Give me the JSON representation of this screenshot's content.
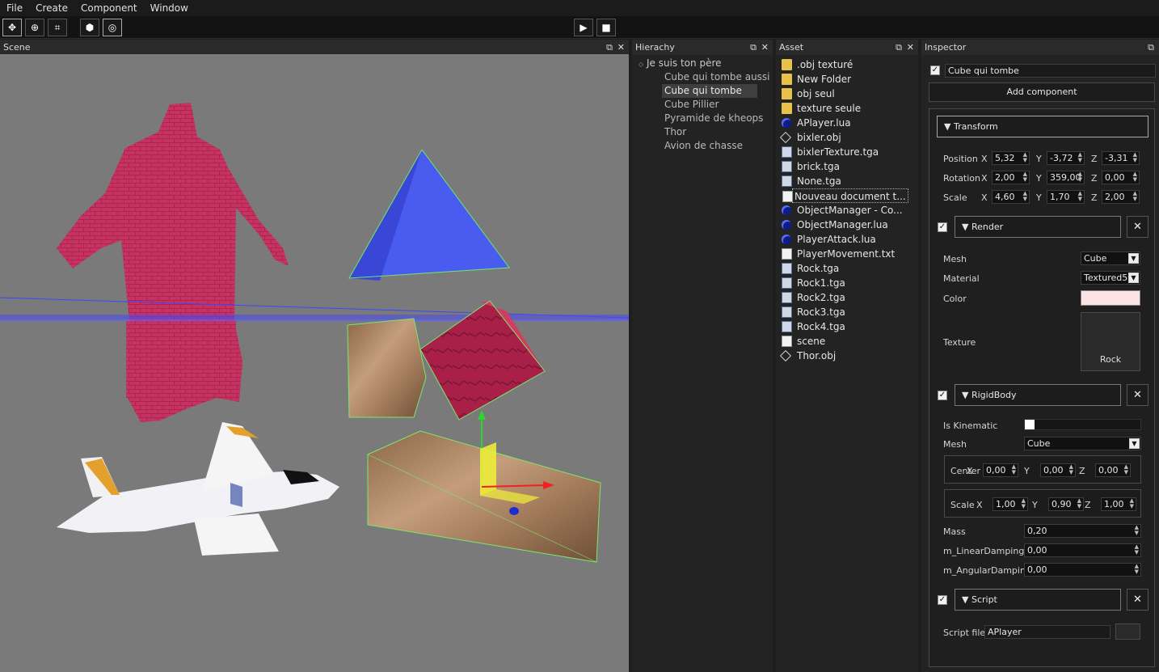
{
  "menu": [
    "File",
    "Create",
    "Component",
    "Window"
  ],
  "panels": {
    "scene": "Scene",
    "hierarchy": "Hierachy",
    "asset": "Asset",
    "inspector": "Inspector"
  },
  "hierarchy": {
    "root": "Je suis ton père",
    "children": [
      "Cube qui tombe aussi",
      "Cube qui tombe",
      "Cube Pillier",
      "Pyramide de kheops",
      "Thor",
      "Avion de chasse"
    ],
    "selected_index": 1
  },
  "assets": [
    {
      "name": ".obj texturé",
      "icon": "folder-icon"
    },
    {
      "name": "New Folder",
      "icon": "folder-icon"
    },
    {
      "name": "obj seul",
      "icon": "folder-icon"
    },
    {
      "name": "texture seule",
      "icon": "folder-icon"
    },
    {
      "name": "APlayer.lua",
      "icon": "lua-icon"
    },
    {
      "name": "bixler.obj",
      "icon": "obj-icon"
    },
    {
      "name": "bixlerTexture.tga",
      "icon": "image-icon"
    },
    {
      "name": "brick.tga",
      "icon": "image-icon"
    },
    {
      "name": "None.tga",
      "icon": "image-icon"
    },
    {
      "name": "Nouveau document t...",
      "icon": "document-icon"
    },
    {
      "name": "ObjectManager - Co...",
      "icon": "lua-icon"
    },
    {
      "name": "ObjectManager.lua",
      "icon": "lua-icon"
    },
    {
      "name": "PlayerAttack.lua",
      "icon": "lua-icon"
    },
    {
      "name": "PlayerMovement.txt",
      "icon": "document-icon"
    },
    {
      "name": "Rock.tga",
      "icon": "image-icon"
    },
    {
      "name": "Rock1.tga",
      "icon": "image-icon"
    },
    {
      "name": "Rock2.tga",
      "icon": "image-icon"
    },
    {
      "name": "Rock3.tga",
      "icon": "image-icon"
    },
    {
      "name": "Rock4.tga",
      "icon": "image-icon"
    },
    {
      "name": "scene",
      "icon": "document-icon"
    },
    {
      "name": "Thor.obj",
      "icon": "obj-icon"
    }
  ],
  "inspector": {
    "object_name": "Cube qui tombe",
    "add_component": "Add component",
    "transform": {
      "title": "Transform",
      "position_label": "Position",
      "rotation_label": "Rotation",
      "scale_label": "Scale",
      "x": "X",
      "y": "Y",
      "z": "Z",
      "position": [
        "5,32",
        "-3,72",
        "-3,31"
      ],
      "rotation": [
        "2,00",
        "359,00",
        "0,00"
      ],
      "scale": [
        "4,60",
        "1,70",
        "2,00"
      ]
    },
    "render": {
      "title": "Render",
      "mesh_label": "Mesh",
      "mesh": "Cube",
      "material_label": "Material",
      "material": "Textured5",
      "color_label": "Color",
      "color": "#fde4e4",
      "texture_label": "Texture",
      "texture": "Rock"
    },
    "rigidbody": {
      "title": "RigidBody",
      "kinematic_label": "Is Kinematic",
      "mesh_label": "Mesh",
      "mesh": "Cube",
      "center_label": "Center",
      "center": [
        "0,00",
        "0,00",
        "0,00"
      ],
      "scale_label": "Scale",
      "scale": [
        "1,00",
        "0,90",
        "1,00"
      ],
      "mass_label": "Mass",
      "mass": "0,20",
      "linear_label": "m_LinearDamping",
      "linear": "0,00",
      "angular_label": "m_AngularDamping",
      "angular": "0,00"
    },
    "script": {
      "title": "Script",
      "file_label": "Script file",
      "file": "APlayer"
    }
  },
  "colors": {
    "accent_blue": "#4a5cf0",
    "panel": "#232323"
  }
}
